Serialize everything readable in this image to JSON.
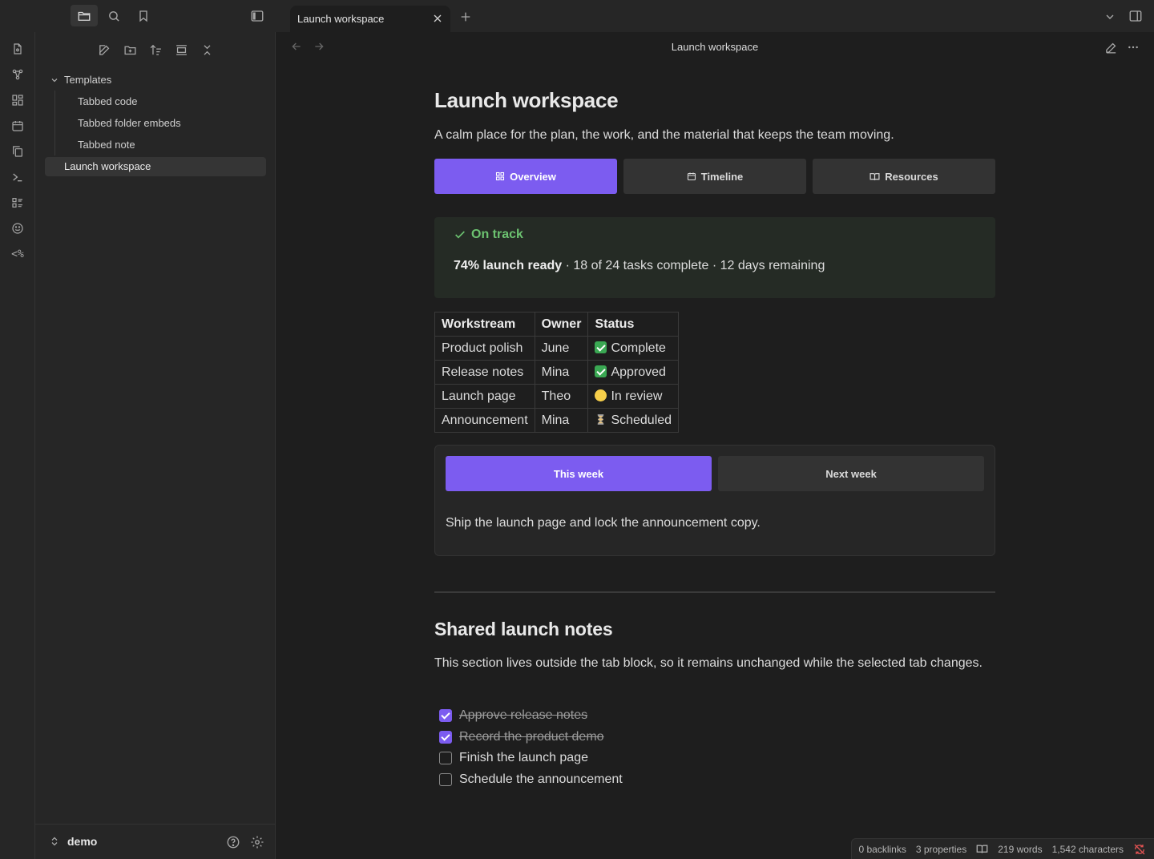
{
  "sidebar_top": {
    "icons": [
      "folder-icon",
      "search-icon",
      "bookmark-icon",
      "sidebar-toggle-icon"
    ]
  },
  "tabbar": {
    "active_tab_title": "Launch workspace",
    "new_tab_label": "+"
  },
  "ribbon": {
    "icons": [
      "file-icon",
      "graph-icon",
      "canvas-icon",
      "calendar-icon",
      "copy-icon",
      "terminal-icon",
      "command-icon",
      "smile-icon",
      "template-icon"
    ]
  },
  "file_explorer": {
    "folder": "Templates",
    "children": [
      "Tabbed code",
      "Tabbed folder embeds",
      "Tabbed note"
    ],
    "active_file": "Launch workspace"
  },
  "vault": {
    "name": "demo"
  },
  "view_header": {
    "title": "Launch workspace"
  },
  "doc": {
    "title": "Launch workspace",
    "intro": "A calm place for the plan, the work, and the material that keeps the team moving.",
    "tabs": [
      "Overview",
      "Timeline",
      "Resources"
    ],
    "active_tab": "Overview",
    "callout": {
      "title": "On track",
      "bold": "74% launch ready",
      "rest": " · 18 of 24 tasks complete · 12 days remaining"
    },
    "table": {
      "headers": [
        "Workstream",
        "Owner",
        "Status"
      ],
      "rows": [
        [
          "Product polish",
          "June",
          "Complete"
        ],
        [
          "Release notes",
          "Mina",
          "Approved"
        ],
        [
          "Launch page",
          "Theo",
          "In review"
        ],
        [
          "Announcement",
          "Mina",
          "Scheduled"
        ]
      ],
      "status_icons": [
        "check",
        "check",
        "dot",
        "glass"
      ]
    },
    "week_tabs": [
      "This week",
      "Next week"
    ],
    "week_text": "Ship the launch page and lock the announcement copy.",
    "shared_heading": "Shared launch notes",
    "shared_text": "This section lives outside the tab block, so it remains unchanged while the selected tab changes.",
    "tasks": [
      {
        "label": "Approve release notes",
        "done": true
      },
      {
        "label": "Record the product demo",
        "done": true
      },
      {
        "label": "Finish the launch page",
        "done": false
      },
      {
        "label": "Schedule the announcement",
        "done": false
      }
    ]
  },
  "statusbar": {
    "backlinks": "0 backlinks",
    "properties": "3 properties",
    "words": "219 words",
    "characters": "1,542 characters"
  },
  "colors": {
    "accent": "#7c5cf0",
    "success": "#6cc270",
    "background": "#1e1e1e",
    "panel": "#262626"
  }
}
